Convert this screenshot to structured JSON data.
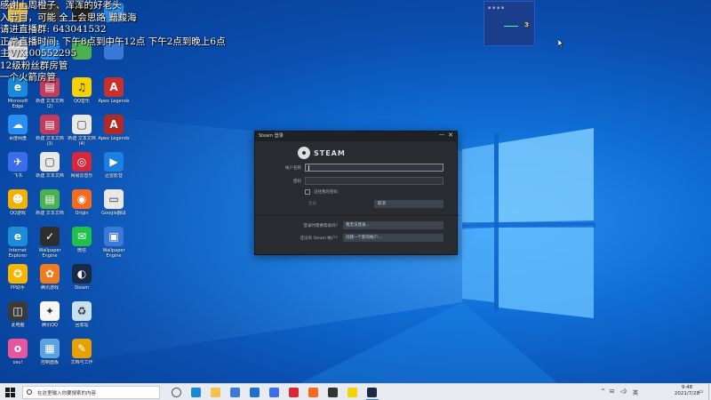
{
  "overlay_text": [
    "感谢上周橙子、浑浑的好老头",
    "入节目，可能 全上会思路 黯黢海",
    "请进直播群: 643041532",
    "正常直播时间: 下午8点到中午12点 下午2点到晚上6点",
    "主V/X:00552295",
    "12级粉丝群房管",
    "一个火箭房管"
  ],
  "desktop_icons": [
    {
      "label": "Microsoft Edge",
      "color": "#1b8ad6",
      "glyph": "e",
      "col": 0,
      "row": 0
    },
    {
      "label": "新建 文本文档 (2)",
      "color": "#c23b5a",
      "glyph": "▤",
      "col": 1,
      "row": 0
    },
    {
      "label": "QQ音乐",
      "color": "#f5d300",
      "glyph": "♫",
      "col": 2,
      "row": 0
    },
    {
      "label": "Apex Legends",
      "color": "#c9302c",
      "glyph": "A",
      "col": 3,
      "row": 0
    },
    {
      "label": "百度网盘",
      "color": "#2a8ef0",
      "glyph": "☁",
      "col": 0,
      "row": 1
    },
    {
      "label": "新建 文本文档 (3)",
      "color": "#c23b5a",
      "glyph": "▤",
      "col": 1,
      "row": 1
    },
    {
      "label": "新建 文本文档 (4)",
      "color": "#e8e8e8",
      "glyph": "▢",
      "col": 2,
      "row": 1
    },
    {
      "label": "Apex Legends",
      "color": "#b22a26",
      "glyph": "A",
      "col": 3,
      "row": 1
    },
    {
      "label": "飞书",
      "color": "#3a6ee8",
      "glyph": "✈",
      "col": 0,
      "row": 2
    },
    {
      "label": "新建 文本文档",
      "color": "#e8e8e8",
      "glyph": "▢",
      "col": 1,
      "row": 2
    },
    {
      "label": "网易云音乐",
      "color": "#d8263a",
      "glyph": "◎",
      "col": 2,
      "row": 2
    },
    {
      "label": "迅雷影音",
      "color": "#1a7fe0",
      "glyph": "▶",
      "col": 3,
      "row": 2
    },
    {
      "label": "QQ游戏",
      "color": "#f5b000",
      "glyph": "☻",
      "col": 0,
      "row": 3
    },
    {
      "label": "新建 文本文档",
      "color": "#4caf50",
      "glyph": "▤",
      "col": 1,
      "row": 3
    },
    {
      "label": "Origin",
      "color": "#f56b1e",
      "glyph": "◉",
      "col": 2,
      "row": 3
    },
    {
      "label": "Google翻译",
      "color": "#e8e8e8",
      "glyph": "▭",
      "col": 3,
      "row": 3
    },
    {
      "label": "Internet Explorer",
      "color": "#1e8bd8",
      "glyph": "e",
      "col": 0,
      "row": 4
    },
    {
      "label": "Wallpaper Engine",
      "color": "#2e2e2e",
      "glyph": "✓",
      "col": 1,
      "row": 4
    },
    {
      "label": "微信",
      "color": "#20c04a",
      "glyph": "✉",
      "col": 2,
      "row": 4
    },
    {
      "label": "Wallpaper Engine",
      "color": "#3b78d8",
      "glyph": "▣",
      "col": 3,
      "row": 4
    },
    {
      "label": "PP助手",
      "color": "#f7b500",
      "glyph": "✪",
      "col": 0,
      "row": 5
    },
    {
      "label": "腾讯游戏",
      "color": "#f07a1e",
      "glyph": "✿",
      "col": 1,
      "row": 5
    },
    {
      "label": "Steam",
      "color": "#1b2a44",
      "glyph": "◐",
      "col": 2,
      "row": 5
    },
    {
      "label": "此电脑",
      "color": "#3a3a3a",
      "glyph": "◫",
      "col": 0,
      "row": 6
    },
    {
      "label": "腾讯QQ",
      "color": "#f7f7f7",
      "glyph": "✦",
      "col": 1,
      "row": 6
    },
    {
      "label": "回收站",
      "color": "#c7dff0",
      "glyph": "♻",
      "col": 2,
      "row": 6
    },
    {
      "label": "osu!",
      "color": "#e8559c",
      "glyph": "o",
      "col": 0,
      "row": 7
    },
    {
      "label": "控制面板",
      "color": "#5ba3e0",
      "glyph": "▦",
      "col": 1,
      "row": 7
    },
    {
      "label": "文档与工作",
      "color": "#e8a000",
      "glyph": "✎",
      "col": 2,
      "row": 7
    }
  ],
  "mini_widget": {
    "number": "3"
  },
  "steam_login": {
    "window_title": "Steam 登录",
    "minimize_glyph": "—",
    "close_glyph": "✕",
    "logo_text": "STEAM",
    "username_label": "帐户名称",
    "password_label": "密码",
    "remember_label": "记住我的密码",
    "login_button": "登录",
    "cancel_button": "取消",
    "help_question": "登录时需要帮助吗？",
    "help_button": "我无法登录...",
    "no_account_question": "还没有 Steam 帐户？",
    "create_button": "创建一个新的帐户..."
  },
  "taskbar": {
    "search_placeholder": "在这里输入你要搜索的内容",
    "apps": [
      {
        "name": "task-view",
        "color": "#555555"
      },
      {
        "name": "edge",
        "color": "#1b8ad6"
      },
      {
        "name": "file-explorer",
        "color": "#f2c14e"
      },
      {
        "name": "store",
        "color": "#3b78d8"
      },
      {
        "name": "mail",
        "color": "#1e6fd0"
      },
      {
        "name": "feishu",
        "color": "#3a6ee8"
      },
      {
        "name": "app-red",
        "color": "#d8263a"
      },
      {
        "name": "origin",
        "color": "#f56b1e"
      },
      {
        "name": "obs",
        "color": "#333333"
      },
      {
        "name": "qq-music",
        "color": "#f5d300"
      },
      {
        "name": "steam",
        "color": "#1b2a44",
        "active": true
      }
    ],
    "tray_up": "^",
    "tray_net": "⊟",
    "tray_vol": "◁)",
    "ime": "英",
    "time": "9:48",
    "date": "2021/7/28",
    "notif": "▭"
  }
}
